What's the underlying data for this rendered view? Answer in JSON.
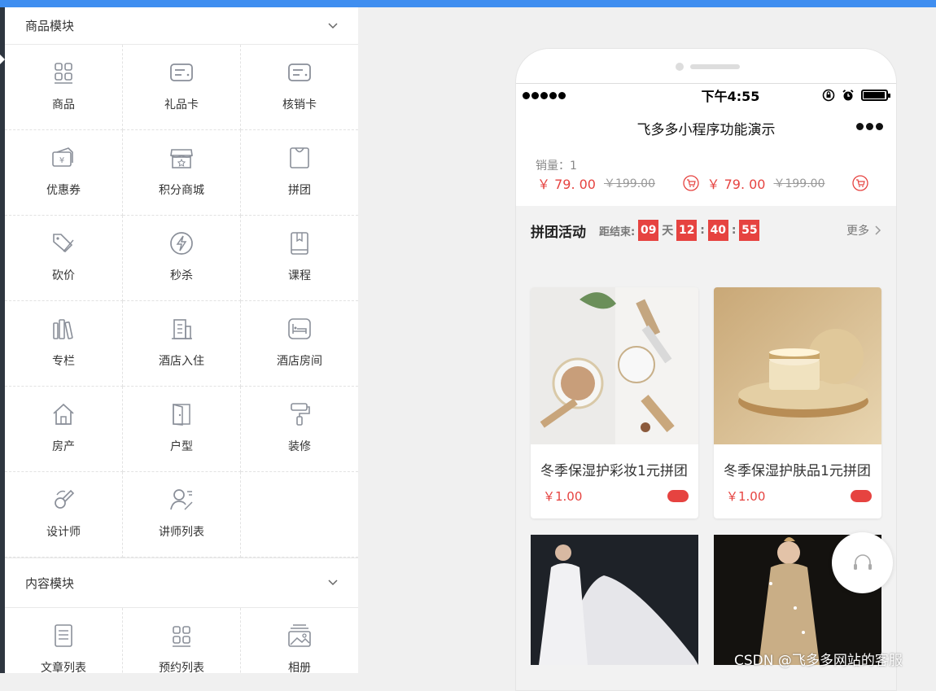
{
  "left_panel": {
    "section1": {
      "title": "商品模块"
    },
    "items": [
      {
        "label": "商品",
        "icon": "grid-icon"
      },
      {
        "label": "礼品卡",
        "icon": "card-icon"
      },
      {
        "label": "核销卡",
        "icon": "card-icon"
      },
      {
        "label": "优惠券",
        "icon": "coupon-icon"
      },
      {
        "label": "积分商城",
        "icon": "store-icon"
      },
      {
        "label": "拼团",
        "icon": "bag-icon"
      },
      {
        "label": "砍价",
        "icon": "tag-icon"
      },
      {
        "label": "秒杀",
        "icon": "lightning-icon"
      },
      {
        "label": "课程",
        "icon": "book-icon"
      },
      {
        "label": "专栏",
        "icon": "books-icon"
      },
      {
        "label": "酒店入住",
        "icon": "building-icon"
      },
      {
        "label": "酒店房间",
        "icon": "bed-icon"
      },
      {
        "label": "房产",
        "icon": "house-icon"
      },
      {
        "label": "户型",
        "icon": "door-icon"
      },
      {
        "label": "装修",
        "icon": "paint-roller-icon"
      },
      {
        "label": "设计师",
        "icon": "designer-icon"
      },
      {
        "label": "讲师列表",
        "icon": "lecturer-icon"
      }
    ],
    "section2": {
      "title": "内容模块"
    },
    "items2": [
      {
        "label": "文章列表",
        "icon": "article-icon"
      },
      {
        "label": "预约列表",
        "icon": "grid-icon"
      },
      {
        "label": "相册",
        "icon": "album-icon"
      }
    ]
  },
  "phone": {
    "status": {
      "time": "下午4:55"
    },
    "nav_title": "飞多多小程序功能演示",
    "sales_text": "销量：1",
    "prices": [
      {
        "now": "￥ 79. 00",
        "old": "￥199.00"
      },
      {
        "now": "￥ 79. 00",
        "old": "￥199.00"
      }
    ],
    "activity": {
      "title": "拼团活动",
      "countdown_label": "距结束:",
      "days": "09",
      "day_unit": "天",
      "hours": "12",
      "minutes": "40",
      "seconds": "55",
      "sep": ":",
      "more": "更多"
    },
    "products": [
      {
        "name": "冬季保湿护彩妆1元拼团",
        "price": "￥1.00"
      },
      {
        "name": "冬季保湿护肤品1元拼团",
        "price": "￥1.00"
      }
    ]
  },
  "watermark": "CSDN @飞多多网站的客服",
  "colors": {
    "accent": "#e64340",
    "topbar": "#3f8ef0",
    "icon_gray": "#8a8f99"
  }
}
